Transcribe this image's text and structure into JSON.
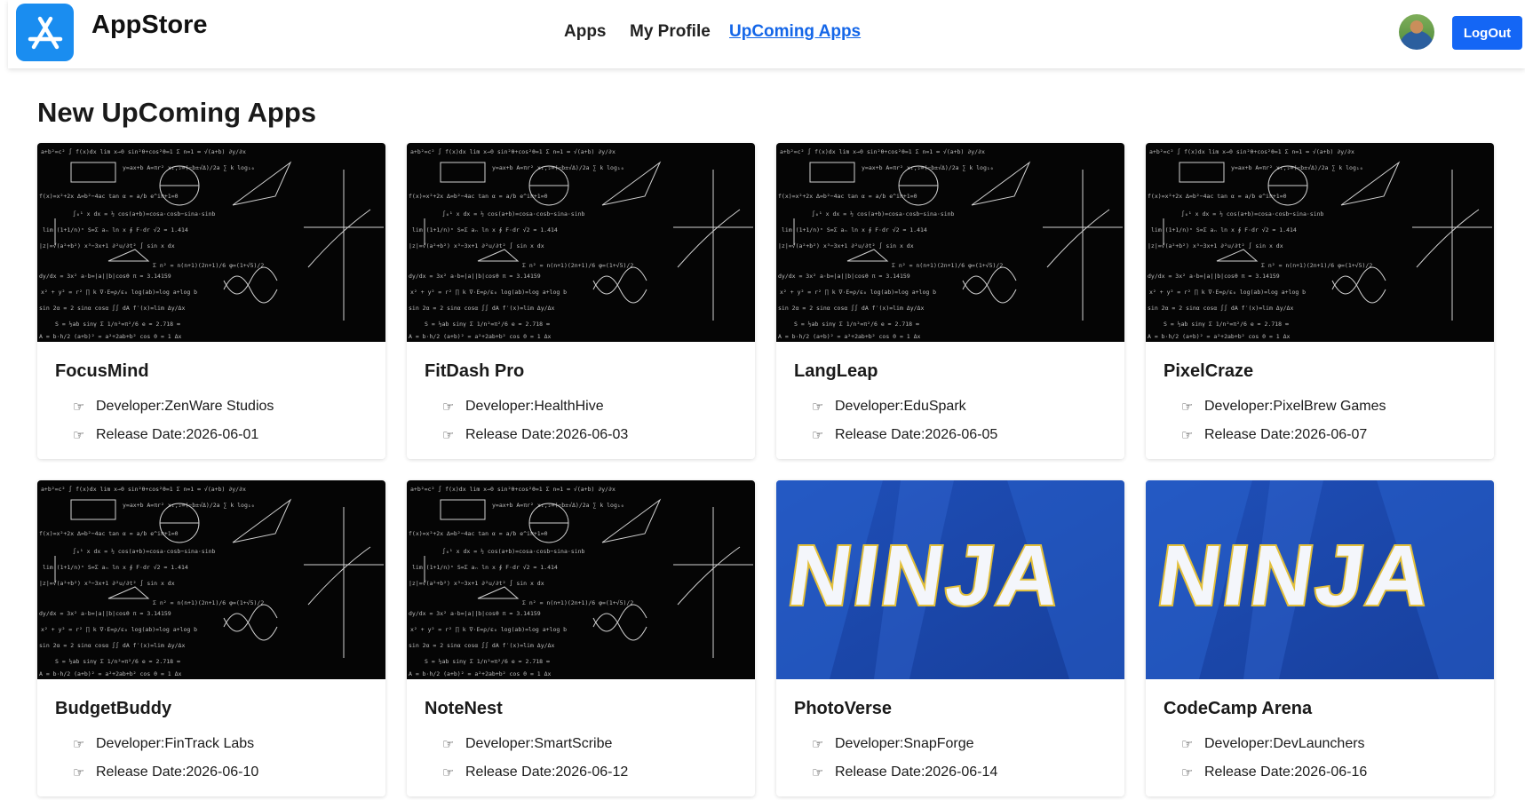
{
  "header": {
    "brand": "AppStore",
    "nav": [
      {
        "label": "Apps",
        "active": false
      },
      {
        "label": "My Profile",
        "active": false
      },
      {
        "label": "UpComing Apps",
        "active": true
      }
    ],
    "logout_label": "LogOut",
    "accent_color": "#1466f5"
  },
  "main": {
    "title": "New UpComing Apps",
    "developer_prefix": "Developer: ",
    "release_prefix": "Release Date: ",
    "meta_icon": "hand-pointing-icon",
    "apps": [
      {
        "name": "FocusMind",
        "developer": "ZenWare Studios",
        "release_date": "2026-06-01",
        "image": "math-chalkboard"
      },
      {
        "name": "FitDash Pro",
        "developer": "HealthHive",
        "release_date": "2026-06-03",
        "image": "math-chalkboard"
      },
      {
        "name": "LangLeap",
        "developer": "EduSpark",
        "release_date": "2026-06-05",
        "image": "math-chalkboard"
      },
      {
        "name": "PixelCraze",
        "developer": "PixelBrew Games",
        "release_date": "2026-06-07",
        "image": "math-chalkboard"
      },
      {
        "name": "BudgetBuddy",
        "developer": "FinTrack Labs",
        "release_date": "2026-06-10",
        "image": "math-chalkboard"
      },
      {
        "name": "NoteNest",
        "developer": "SmartScribe",
        "release_date": "2026-06-12",
        "image": "math-chalkboard"
      },
      {
        "name": "PhotoVerse",
        "developer": "SnapForge",
        "release_date": "2026-06-14",
        "image": "ninja-logo"
      },
      {
        "name": "CodeCamp Arena",
        "developer": "DevLaunchers",
        "release_date": "2026-06-16",
        "image": "ninja-logo"
      }
    ]
  }
}
